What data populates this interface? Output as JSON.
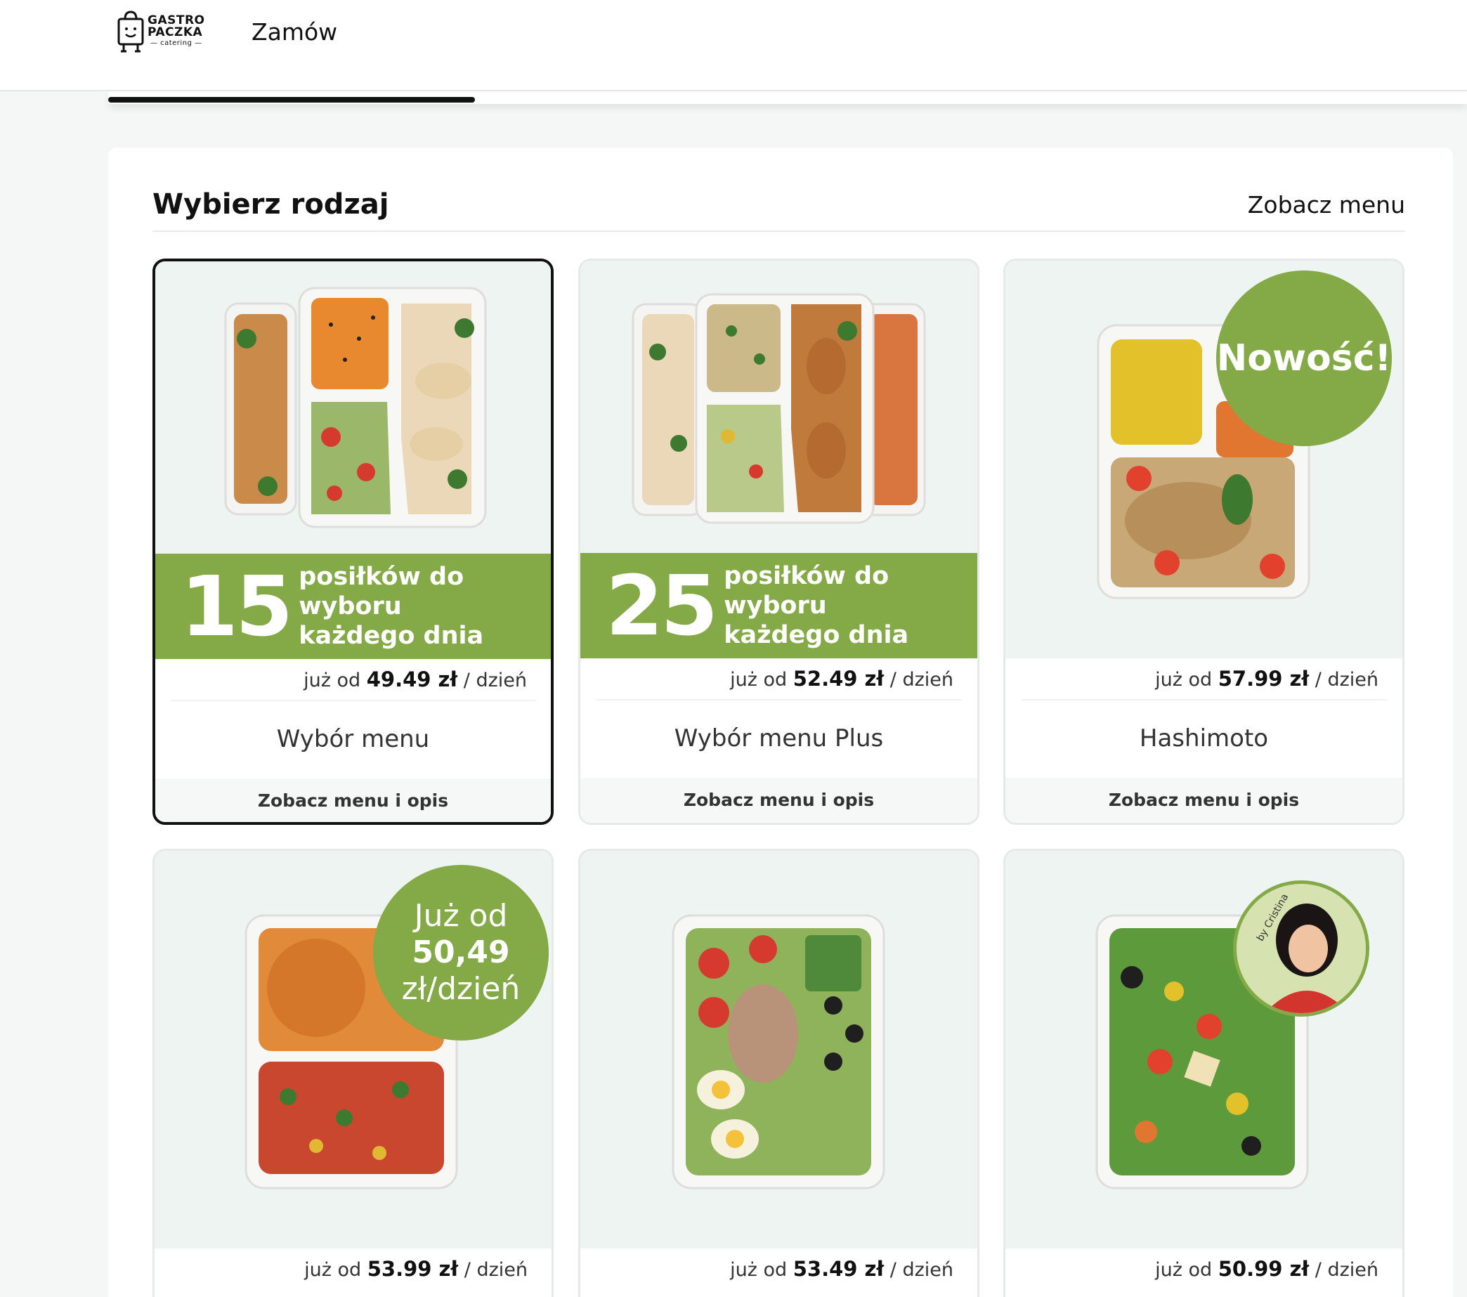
{
  "header": {
    "logo": {
      "line1": "GASTRO",
      "line2": "PACZKA",
      "line3": "catering"
    },
    "nav_order": "Zamów"
  },
  "progress": {
    "fraction": 0.27
  },
  "section": {
    "title": "Wybierz rodzaj",
    "see_menu": "Zobacz menu"
  },
  "cards": [
    {
      "banner_number": "15",
      "banner_line1": "posiłków do wyboru",
      "banner_line2": "każdego dnia",
      "price_prefix": "już od",
      "price": "49.49 zł",
      "price_suffix": "/ dzień",
      "name": "Wybór menu",
      "footer": "Zobacz menu i opis",
      "selected": true
    },
    {
      "banner_number": "25",
      "banner_line1": "posiłków do wyboru",
      "banner_line2": "każdego dnia",
      "price_prefix": "już od",
      "price": "52.49 zł",
      "price_suffix": "/ dzień",
      "name": "Wybór menu Plus",
      "footer": "Zobacz menu i opis",
      "selected": false
    },
    {
      "badge": "Nowość!",
      "price_prefix": "już od",
      "price": "57.99 zł",
      "price_suffix": "/ dzień",
      "name": "Hashimoto",
      "footer": "Zobacz menu i opis",
      "selected": false
    },
    {
      "badge_line1": "Już od",
      "badge_line2": "50,49",
      "badge_line3": "zł/dzień",
      "price_prefix": "już od",
      "price": "53.99 zł",
      "price_suffix": "/ dzień"
    },
    {
      "price_prefix": "już od",
      "price": "53.49 zł",
      "price_suffix": "/ dzień"
    },
    {
      "badge_caption": "by Cristina",
      "price_prefix": "już od",
      "price": "50.99 zł",
      "price_suffix": "/ dzień"
    }
  ],
  "colors": {
    "accent_green": "#84a947",
    "card_bg": "#eef4f2",
    "selected_border": "#111111"
  },
  "icons": [
    "bag-logo-icon"
  ]
}
